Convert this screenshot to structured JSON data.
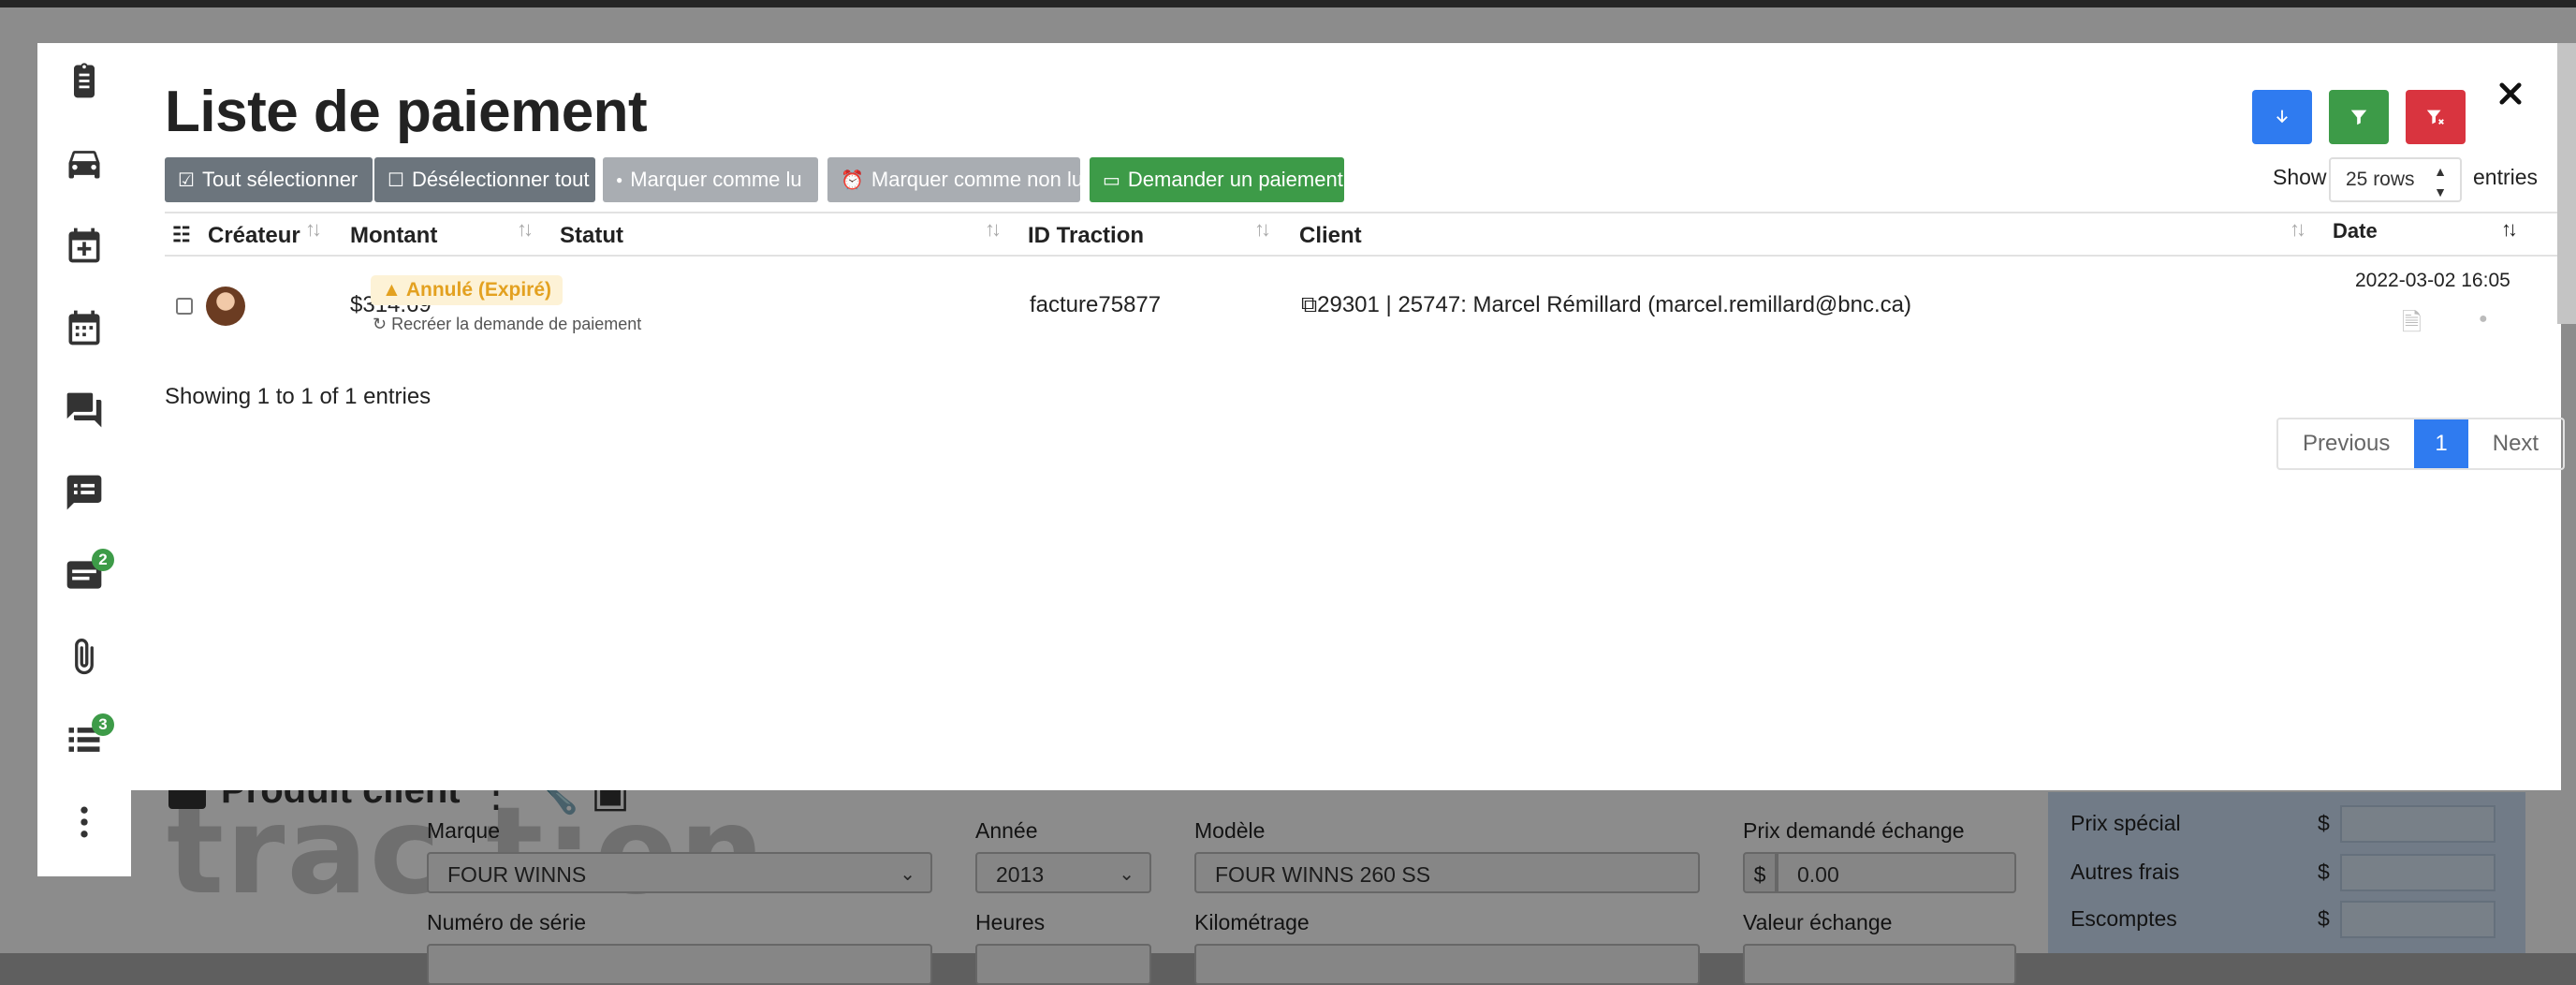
{
  "modal": {
    "title": "Liste de paiement",
    "toolbar_buttons": {
      "select_all": "Tout sélectionner",
      "deselect_all": "Désélectionner tout",
      "mark_read": "Marquer comme lu",
      "mark_unread": "Marquer comme non lu",
      "request_payment": "Demander un paiement"
    },
    "icon_buttons": [
      {
        "name": "download-icon",
        "color": "#2f7bf0"
      },
      {
        "name": "filter-icon",
        "color": "#3d9b48"
      },
      {
        "name": "clear-filter-icon",
        "color": "#d9343f"
      }
    ],
    "show_label": "Show",
    "rows_value": "25 rows",
    "entries_label": "entries",
    "columns": [
      "Créateur",
      "Montant",
      "Statut",
      "ID Traction",
      "Client",
      "Date"
    ],
    "rows": [
      {
        "amount": "$314.69",
        "status": "Annulé (Expiré)",
        "status_action": "Recréer la demande de paiement",
        "traction_id": "facture75877",
        "client": "29301 | 25747: Marcel Rémillard (marcel.remillard@bnc.ca)",
        "date": "2022-03-02 16:05"
      }
    ],
    "footer_info": "Showing 1 to 1 of 1 entries",
    "pagination": {
      "previous": "Previous",
      "current": "1",
      "next": "Next"
    }
  },
  "sidebar": {
    "items": [
      {
        "icon": "clipboard-icon"
      },
      {
        "icon": "car-icon"
      },
      {
        "icon": "calendar-plus-icon"
      },
      {
        "icon": "calendar-icon"
      },
      {
        "icon": "chat-icon"
      },
      {
        "icon": "message-list-icon"
      },
      {
        "icon": "payment-card-icon",
        "badge": "2"
      },
      {
        "icon": "paperclip-icon"
      },
      {
        "icon": "task-list-icon",
        "badge": "3"
      },
      {
        "icon": "more-icon"
      }
    ]
  },
  "background": {
    "logo_text": "trac t:on",
    "section_title": "Produit client",
    "fields": {
      "marque_label": "Marque",
      "marque_value": "FOUR WINNS",
      "annee_label": "Année",
      "annee_value": "2013",
      "modele_label": "Modèle",
      "modele_value": "FOUR WINNS 260 SS",
      "prix_label": "Prix demandé échange",
      "prix_value": "0.00",
      "serie_label": "Numéro de série",
      "heures_label": "Heures",
      "km_label": "Kilométrage",
      "valeur_label": "Valeur échange",
      "currency": "$"
    },
    "right_panel": [
      "Prix spécial",
      "Autres frais",
      "Escomptes"
    ]
  }
}
